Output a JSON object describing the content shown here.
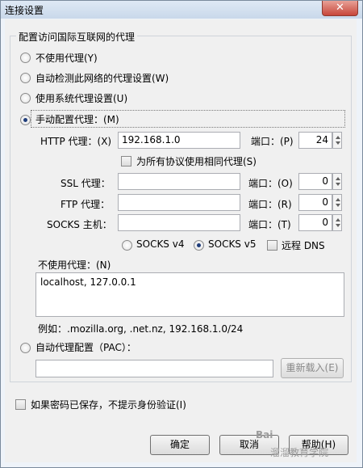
{
  "window": {
    "title": "连接设置",
    "close_glyph": "✕"
  },
  "group": {
    "legend": "配置访问国际互联网的代理"
  },
  "options": {
    "no_proxy": "不使用代理(Y)",
    "auto_detect": "自动检测此网络的代理设置(W)",
    "system_proxy": "使用系统代理设置(U)",
    "manual_proxy": "手动配置代理：(M)"
  },
  "manual": {
    "http_label": "HTTP 代理：(X)",
    "http_value": "192.168.1.0",
    "http_port_label": "端口：(P)",
    "http_port": "24",
    "same_proxy_label": "为所有协议使用相同代理(S)",
    "ssl_label": "SSL 代理：",
    "ssl_port_label": "端口：(O)",
    "ssl_port": "0",
    "ftp_label": "FTP 代理：",
    "ftp_port_label": "端口：(R)",
    "ftp_port": "0",
    "socks_label": "SOCKS 主机：",
    "socks_port_label": "端口：(T)",
    "socks_port": "0",
    "socks_v4": "SOCKS v4",
    "socks_v5": "SOCKS v5",
    "remote_dns": "远程 DNS"
  },
  "no_proxy_for": {
    "label": "不使用代理：(N)",
    "value": "localhost, 127.0.0.1",
    "example": "例如：.mozilla.org, .net.nz, 192.168.1.0/24"
  },
  "pac": {
    "label": "自动代理配置（PAC）：",
    "reload_button": "重新载入(E)"
  },
  "no_auth_prompt": "如果密码已保存，不提示身份验证(I)",
  "buttons": {
    "ok": "确定",
    "cancel": "取消",
    "help": "帮助(H)"
  },
  "watermark": {
    "line1": "Bai",
    "line2": "溜溜教育学院"
  },
  "state": {
    "proxy_mode": "manual",
    "socks_version": "v5",
    "same_proxy_for_all": false,
    "remote_dns": false,
    "no_auth_prompt": false
  }
}
